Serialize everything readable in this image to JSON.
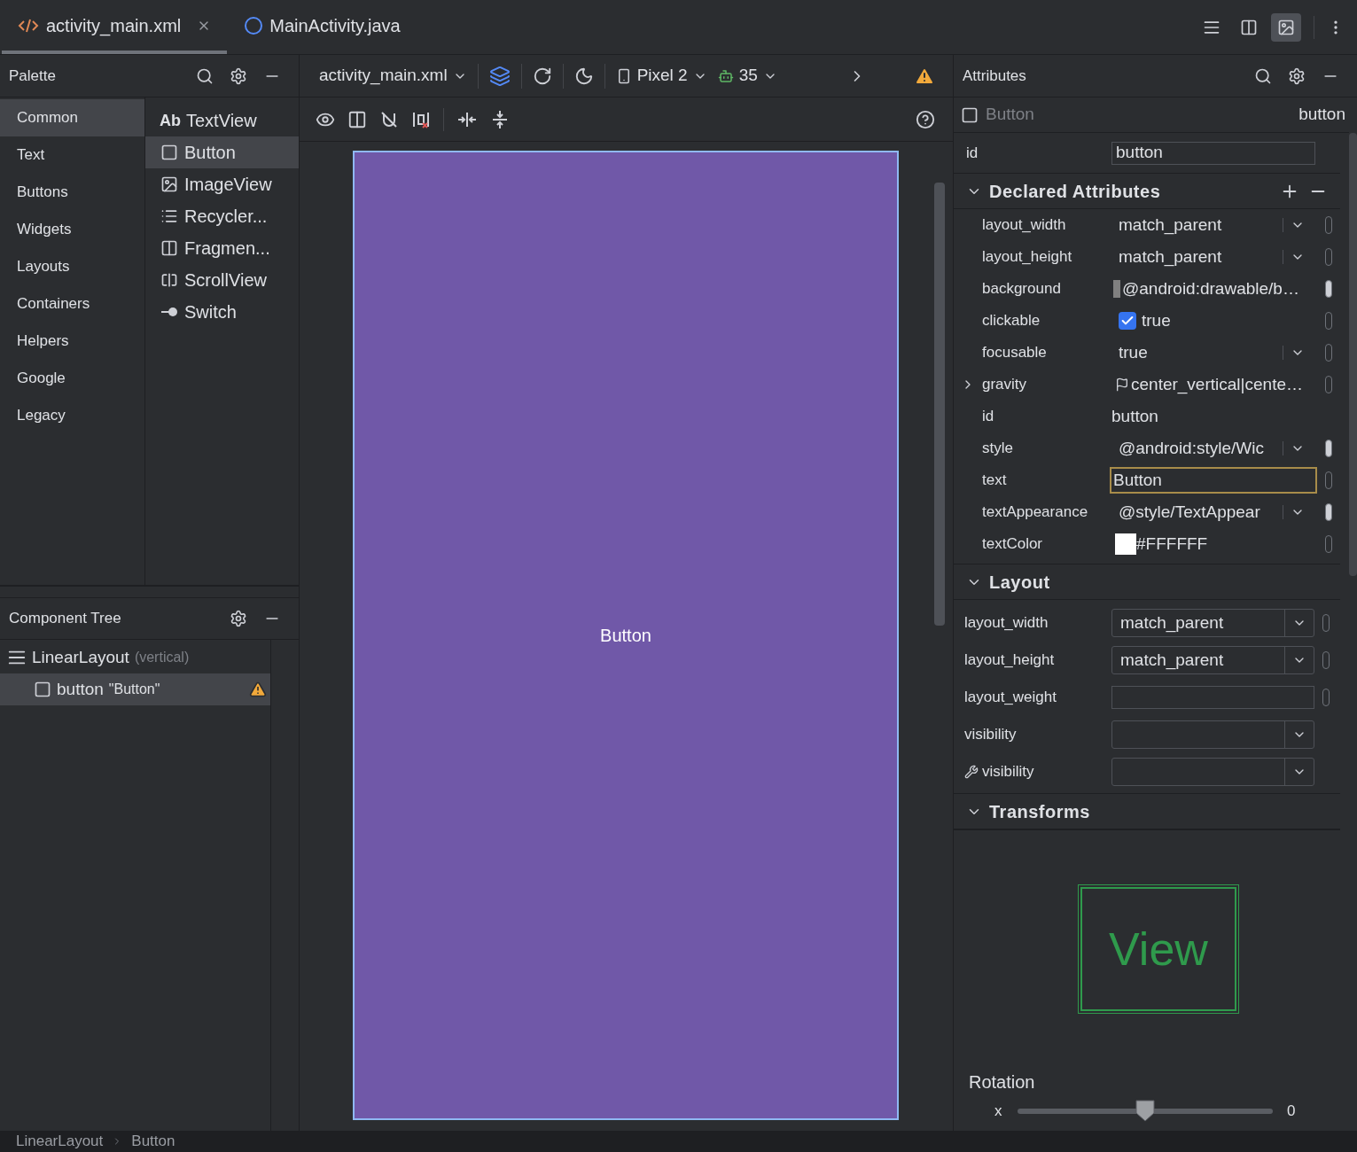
{
  "editor_tabs": [
    {
      "label": "activity_main.xml",
      "kind": "xml",
      "selected": true,
      "closable": true
    },
    {
      "label": "MainActivity.java",
      "kind": "java",
      "selected": false,
      "closable": false
    }
  ],
  "view_modes": [
    {
      "kind": "code",
      "selected": false
    },
    {
      "kind": "split",
      "selected": false
    },
    {
      "kind": "design",
      "selected": true
    }
  ],
  "palette": {
    "title": "Palette",
    "categories": [
      {
        "label": "Common",
        "selected": true
      },
      {
        "label": "Text",
        "selected": false
      },
      {
        "label": "Buttons",
        "selected": false
      },
      {
        "label": "Widgets",
        "selected": false
      },
      {
        "label": "Layouts",
        "selected": false
      },
      {
        "label": "Containers",
        "selected": false
      },
      {
        "label": "Helpers",
        "selected": false
      },
      {
        "label": "Google",
        "selected": false
      },
      {
        "label": "Legacy",
        "selected": false
      }
    ],
    "widgets": [
      {
        "label": "TextView",
        "icon": "Ab",
        "kind": "text",
        "selected": false
      },
      {
        "label": "Button",
        "kind": "button",
        "selected": true
      },
      {
        "label": "ImageView",
        "kind": "image",
        "selected": false
      },
      {
        "label": "Recycler...",
        "kind": "list",
        "selected": false
      },
      {
        "label": "Fragmen...",
        "kind": "fragment",
        "selected": false
      },
      {
        "label": "ScrollView",
        "kind": "scroll",
        "selected": false
      },
      {
        "label": "Switch",
        "kind": "switch",
        "selected": false
      }
    ]
  },
  "component_tree": {
    "title": "Component Tree",
    "nodes": [
      {
        "label": "LinearLayout",
        "detail": "(vertical)",
        "kind": "layout",
        "selected": false,
        "warning": false,
        "children": [
          {
            "label": "button",
            "detail": "\"Button\"",
            "kind": "button",
            "selected": true,
            "warning": true
          }
        ]
      }
    ]
  },
  "design_toolbar": {
    "file": "activity_main.xml",
    "device": "Pixel 2",
    "api": "35",
    "warning": true
  },
  "canvas": {
    "button_text": "Button"
  },
  "attributes": {
    "title": "Attributes",
    "component": {
      "type": "Button",
      "id": "button"
    },
    "id_field": {
      "label": "id",
      "value": "button"
    },
    "declared": {
      "title": "Declared Attributes",
      "expanded": true,
      "rows": [
        {
          "name": "layout_width",
          "value": "match_parent",
          "kind": "dropdown",
          "marker_filled": false
        },
        {
          "name": "layout_height",
          "value": "match_parent",
          "kind": "dropdown",
          "marker_filled": false
        },
        {
          "name": "background",
          "value": "@android:drawable/b…",
          "kind": "drawable",
          "marker_filled": true
        },
        {
          "name": "clickable",
          "value": "true",
          "kind": "checkbox",
          "checked": true,
          "marker_filled": false
        },
        {
          "name": "focusable",
          "value": "true",
          "kind": "dropdown",
          "marker_filled": false
        },
        {
          "name": "gravity",
          "value": "center_vertical|cente…",
          "kind": "flag",
          "expanded": false,
          "marker_filled": false
        },
        {
          "name": "id",
          "value": "button",
          "kind": "plain"
        },
        {
          "name": "style",
          "value": "@android:style/Wic",
          "kind": "dropdown",
          "marker_filled": true
        },
        {
          "name": "text",
          "value": "Button",
          "kind": "field",
          "focused": true,
          "marker_filled": false
        },
        {
          "name": "textAppearance",
          "value": "@style/TextAppear",
          "kind": "dropdown",
          "marker_filled": true
        },
        {
          "name": "textColor",
          "value": "#FFFFFF",
          "kind": "color",
          "color": "#ffffff",
          "marker_filled": false
        }
      ]
    },
    "layout": {
      "title": "Layout",
      "expanded": true,
      "rows": [
        {
          "name": "layout_width",
          "value": "match_parent",
          "kind": "dropdown",
          "tools": false,
          "marker": true
        },
        {
          "name": "layout_height",
          "value": "match_parent",
          "kind": "dropdown",
          "tools": false,
          "marker": true
        },
        {
          "name": "layout_weight",
          "kind": "field",
          "tools": false,
          "marker": true
        },
        {
          "name": "visibility",
          "kind": "dropdown",
          "tools": false,
          "marker": false
        },
        {
          "name": "visibility",
          "kind": "dropdown",
          "tools": true,
          "marker": false
        }
      ]
    },
    "transforms": {
      "title": "Transforms",
      "expanded": true,
      "preview_label": "View",
      "rotation": {
        "title": "Rotation",
        "axis": "x",
        "level": 0.5,
        "reading": "0"
      }
    }
  },
  "breadcrumb": [
    "LinearLayout",
    "Button"
  ]
}
